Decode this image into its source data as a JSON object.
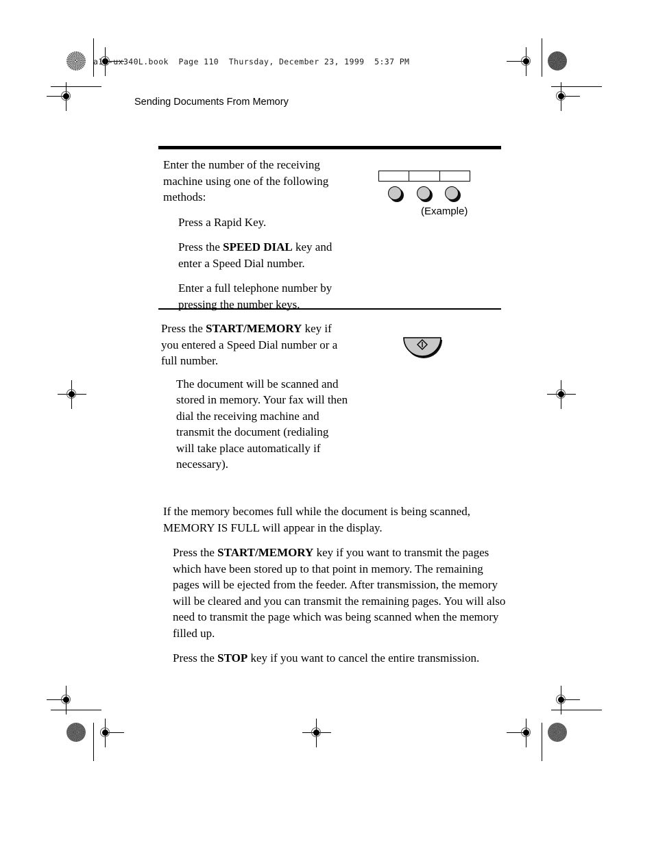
{
  "page": {
    "slug": "a1I-ux340L.book  Page 110  Thursday, December 23, 1999  5:37 PM",
    "running_head": "Sending Documents From Memory"
  },
  "steps": [
    {
      "id": "step-enter-number",
      "intro": "Enter the number of the receiving machine using one of the following methods:",
      "options": [
        "Press a Rapid Key.",
        "Press the SPEED DIAL key and enter a Speed Dial number.",
        "Enter a full telephone number by pressing the number keys."
      ],
      "option2_prefix": "Press the ",
      "option2_bold": "SPEED DIAL",
      "option2_suffix": " key and enter a Speed Dial number.",
      "illustration": "rapid-key-panel",
      "caption": "(Example)"
    },
    {
      "id": "step-press-start-memory",
      "intro_prefix": "Press the ",
      "intro_bold": "START/MEMORY",
      "intro_suffix": " key if you entered a Speed Dial number or a full number.",
      "detail": "The document will be scanned and stored in memory. Your fax will then dial the receiving machine and transmit the document (redialing will take place automatically if necessary).",
      "illustration": "start-memory-key"
    }
  ],
  "notes": {
    "intro": "If the memory becomes full while the document is being scanned, MEMORY IS FULL will appear in the display.",
    "item1_prefix": "Press the ",
    "item1_bold": "START/MEMORY",
    "item1_suffix": " key if you want to transmit the pages which have been stored up to that point in memory. The remaining pages will be ejected from the feeder. After transmission, the memory will be cleared and you can transmit the remaining pages. You will also need to transmit the page which was being scanned when the memory filled up.",
    "item2_prefix": "Press the ",
    "item2_bold": "STOP",
    "item2_suffix": " key if you want to cancel the entire transmission."
  },
  "colors": {
    "rule": "#000000",
    "key_face": "#c8c8c8",
    "key_shadow": "#111111",
    "paper": "#ffffff"
  }
}
